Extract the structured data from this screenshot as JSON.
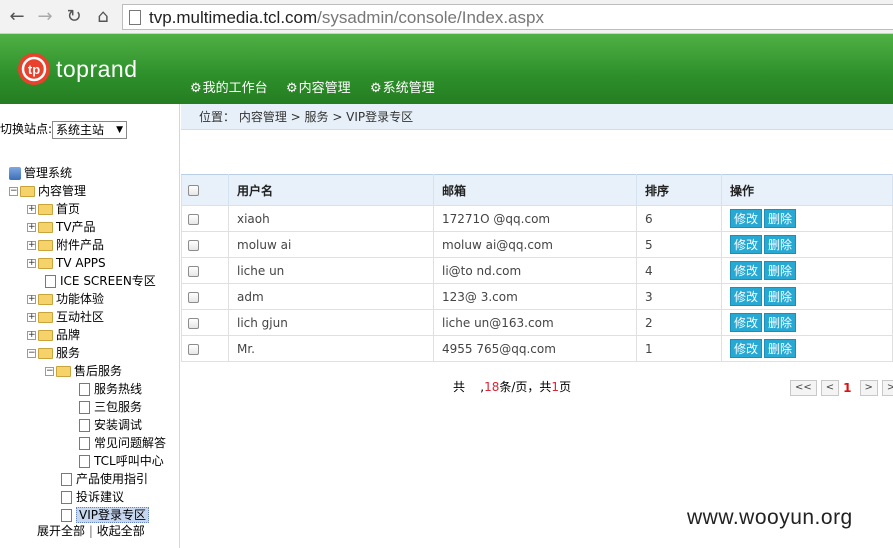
{
  "browser": {
    "url_host": "tvp.multimedia.tcl.com",
    "url_path": "/sysadmin/console/Index.aspx"
  },
  "header": {
    "logo": "toprand",
    "menu": [
      "我的工作台",
      "内容管理",
      "系统管理"
    ]
  },
  "sidebar": {
    "site_label": "切换站点:",
    "site_value": "系统主站",
    "tree": {
      "root": "管理系统",
      "content": "内容管理",
      "home": "首页",
      "tv_products": "TV产品",
      "accessories": "附件产品",
      "tv_apps": "TV APPS",
      "ice_screen": "ICE SCREEN专区",
      "features": "功能体验",
      "community": "互动社区",
      "brand": "品牌",
      "service": "服务",
      "after_sales": "售后服务",
      "hotline": "服务热线",
      "warranty": "三包服务",
      "install": "安装调试",
      "faq": "常见问题解答",
      "call_center": "TCL呼叫中心",
      "guide": "产品使用指引",
      "complaint": "投诉建议",
      "vip": "VIP登录专区"
    },
    "expand_all": "展开全部",
    "collapse_all": "收起全部"
  },
  "breadcrumb": "位置： 内容管理 > 服务 > VIP登录专区",
  "table": {
    "headers": {
      "user": "用户名",
      "email": "邮箱",
      "rank": "排序",
      "ops": "操作"
    },
    "rows": [
      {
        "user": "xiaoh",
        "email": "17271O   @qq.com",
        "rank": "6"
      },
      {
        "user": "moluw   ai",
        "email": "moluw   ai@qq.com",
        "rank": "5"
      },
      {
        "user": "liche   un",
        "email": "li@to   nd.com",
        "rank": "4"
      },
      {
        "user": "adm",
        "email": "123@   3.com",
        "rank": "3"
      },
      {
        "user": "lich   gjun",
        "email": "liche   un@163.com",
        "rank": "2"
      },
      {
        "user": "Mr.",
        "email": "4955   765@qq.com",
        "rank": "1"
      }
    ],
    "edit_label": "修改",
    "delete_label": "删除"
  },
  "pager": {
    "total_prefix": "共",
    "per_page": "18",
    "per_page_suffix": "条/页，共",
    "pages": "1",
    "pages_suffix": "页",
    "first": "<<",
    "prev": "<",
    "current": "1",
    "next": ">",
    "last": ">"
  },
  "watermark": "www.wooyun.org",
  "colors": {
    "header_green": "#2d8f2a",
    "button_blue": "#27a9d4"
  }
}
